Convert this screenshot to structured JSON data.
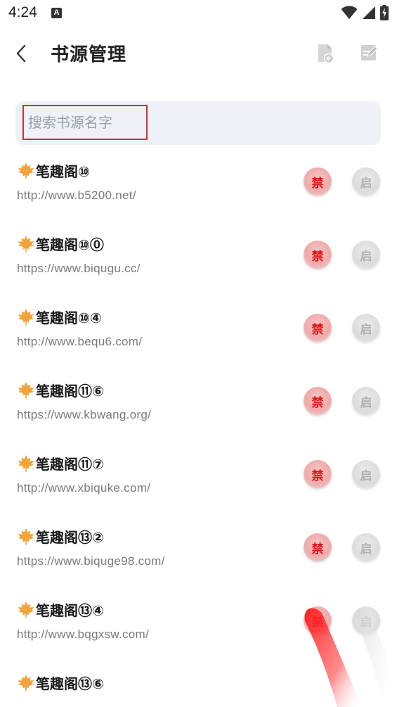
{
  "status_bar": {
    "time": "4:24",
    "notification_badge": "A",
    "icons": [
      "wifi-icon",
      "signal-icon",
      "battery-charging-icon"
    ]
  },
  "header": {
    "back_icon": "chevron-left-icon",
    "title": "书源管理",
    "import_icon": "import-file-icon",
    "edit_icon": "edit-note-icon"
  },
  "search": {
    "value": "",
    "placeholder": "搜索书源名字"
  },
  "colors": {
    "ban_text": "#e01010",
    "enable_text": "#b0b0b0",
    "search_bg": "#eef1f8",
    "highlight_border": "#d32f2f"
  },
  "sources": [
    {
      "name": "笔趣阁⑩",
      "url": "http://www.b5200.net/",
      "ban_label": "禁",
      "enable_label": "启"
    },
    {
      "name": "笔趣阁⑩⓪",
      "url": "https://www.biqugu.cc/",
      "ban_label": "禁",
      "enable_label": "启"
    },
    {
      "name": "笔趣阁⑩④",
      "url": "http://www.bequ6.com/",
      "ban_label": "禁",
      "enable_label": "启"
    },
    {
      "name": "笔趣阁⑪⑥",
      "url": "https://www.kbwang.org/",
      "ban_label": "禁",
      "enable_label": "启"
    },
    {
      "name": "笔趣阁⑪⑦",
      "url": "http://www.xbiquke.com/",
      "ban_label": "禁",
      "enable_label": "启"
    },
    {
      "name": "笔趣阁⑬②",
      "url": "https://www.biquge98.com/",
      "ban_label": "禁",
      "enable_label": "启"
    },
    {
      "name": "笔趣阁⑬④",
      "url": "http://www.bqgxsw.com/",
      "ban_label": "禁",
      "enable_label": "启"
    },
    {
      "name": "笔趣阁⑬⑥",
      "url": "",
      "ban_label": "",
      "enable_label": ""
    }
  ]
}
